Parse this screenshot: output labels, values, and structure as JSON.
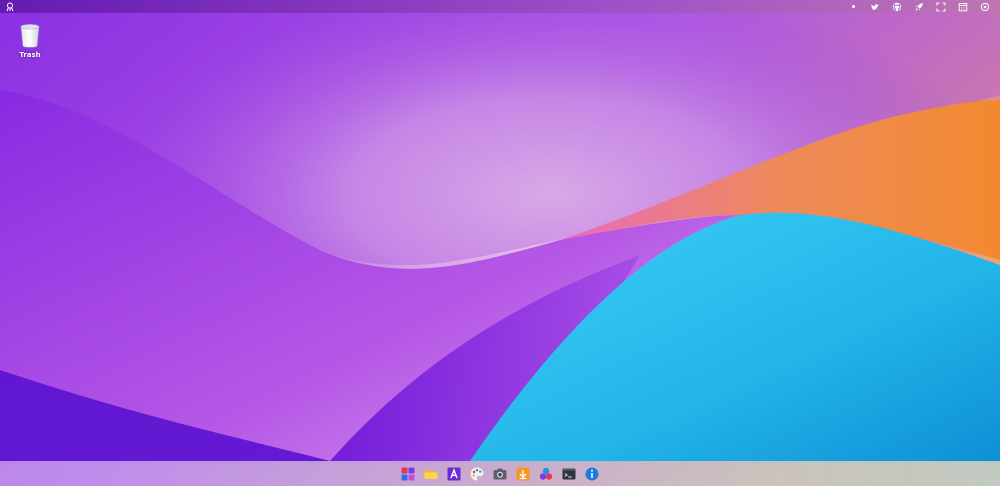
{
  "desktop": {
    "icons": [
      {
        "label": "Trash",
        "icon": "trash-bin-icon"
      }
    ]
  },
  "topbar": {
    "left_icon": "app-menu-logo-icon",
    "right_icons": [
      "status-dot-icon",
      "twitter-icon",
      "github-icon",
      "rocket-icon",
      "fullscreen-icon",
      "calendar-icon",
      "settings-icon"
    ]
  },
  "dock": {
    "items": [
      "start-menu-icon",
      "file-manager-icon",
      "text-editor-icon",
      "paint-icon",
      "camera-icon",
      "download-icon",
      "apps-icon",
      "terminal-icon",
      "about-info-icon"
    ]
  },
  "colors": {
    "accent_purple": "#8a2be2",
    "accent_blue": "#1fb6e8",
    "accent_orange": "#f08a3a"
  }
}
